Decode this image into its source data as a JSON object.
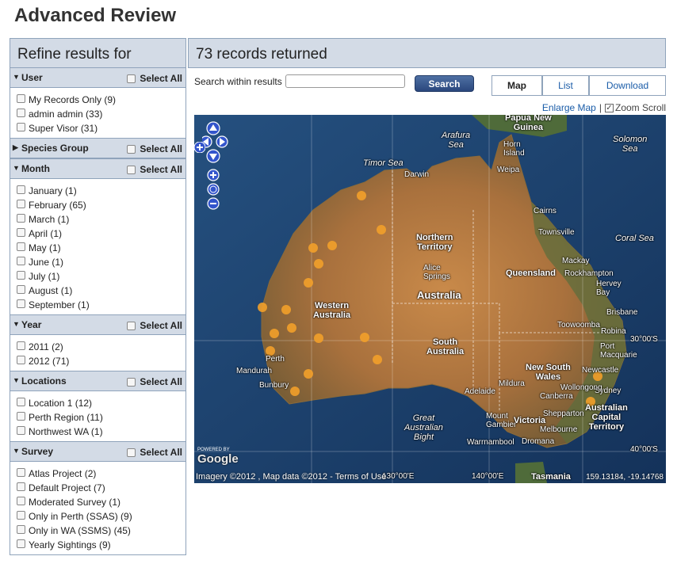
{
  "page_title": "Advanced Review",
  "refine": {
    "heading": "Refine results for",
    "select_all": "Select All",
    "groups": [
      {
        "label": "User",
        "expanded": true,
        "items": [
          "My Records Only (9)",
          "admin admin (33)",
          "Super Visor (31)"
        ]
      },
      {
        "label": "Species Group",
        "expanded": false,
        "items": []
      },
      {
        "label": "Month",
        "expanded": true,
        "items": [
          "January (1)",
          "February (65)",
          "March (1)",
          "April (1)",
          "May (1)",
          "June (1)",
          "July (1)",
          "August (1)",
          "September (1)"
        ]
      },
      {
        "label": "Year",
        "expanded": true,
        "items": [
          "2011 (2)",
          "2012 (71)"
        ]
      },
      {
        "label": "Locations",
        "expanded": true,
        "items": [
          "Location 1 (12)",
          "Perth Region (11)",
          "Northwest WA (1)"
        ]
      },
      {
        "label": "Survey",
        "expanded": true,
        "items": [
          "Atlas Project (2)",
          "Default Project (7)",
          "Moderated Survey (1)",
          "Only in Perth (SSAS) (9)",
          "Only in WA (SSMS) (45)",
          "Yearly Sightings (9)"
        ]
      }
    ]
  },
  "results": {
    "heading": "73 records returned",
    "search_label": "Search within results",
    "search_value": "",
    "search_button": "Search",
    "tabs": [
      "Map",
      "List",
      "Download"
    ],
    "active_tab": "Map",
    "enlarge_map": "Enlarge Map",
    "zoom_scroll": "Zoom Scroll",
    "zoom_scroll_checked": true
  },
  "map": {
    "labels": {
      "arafura": "Arafura\nSea",
      "timor": "Timor Sea",
      "darwin": "Darwin",
      "png": "Papua New\nGuinea",
      "horn": "Horn\nIsland",
      "weipa": "Weipa",
      "solomon": "Solomon\nSea",
      "cairns": "Cairns",
      "townsville": "Townsville",
      "coral": "Coral Sea",
      "nt": "Northern\nTerritory",
      "alice": "Alice\nSprings",
      "qld": "Queensland",
      "mackay": "Mackay",
      "rockhampton": "Rockhampton",
      "hervey": "Hervey\nBay",
      "australia": "Australia",
      "wa": "Western\nAustralia",
      "brisbane": "Brisbane",
      "toowoomba": "Toowoomba",
      "robina": "Robina",
      "lat30": "30°00'S",
      "sa": "South\nAustralia",
      "port": "Port\nMacquarie",
      "nsw": "New South\nWales",
      "newcastle": "Newcastle",
      "perth": "Perth",
      "mandurah": "Mandurah",
      "bunbury": "Bunbury",
      "mildura": "Mildura",
      "adelaide": "Adelaide",
      "sydney": "Sydney",
      "wollongong": "Wollongong",
      "canberra": "Canberra",
      "act": "Australian\nCapital\nTerritory",
      "shepparton": "Shepparton",
      "bight": "Great\nAustralian\nBight",
      "gambier": "Mount\nGambier",
      "victoria": "Victoria",
      "melbourne": "Melbourne",
      "warrnambool": "Warrnambool",
      "dromana": "Dromana",
      "lat40": "40°00'S",
      "tasmania": "Tasmania",
      "lon130": "130°00'E",
      "lon140": "140°00'E"
    },
    "powered_by": "POWERED BY",
    "google": "Google",
    "copyright": "Imagery ©2012 , Map data ©2012 - Terms of Use",
    "coordinates": "159.13184, -19.14768",
    "marker_color": "#f2a02a"
  }
}
